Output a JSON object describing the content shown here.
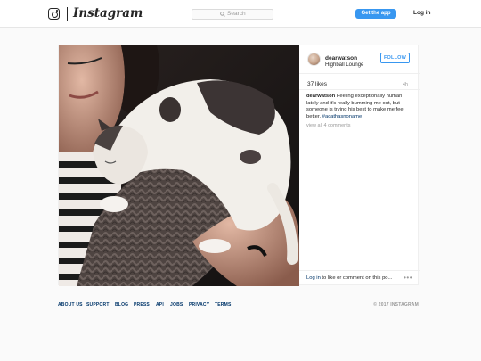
{
  "header": {
    "wordmark": "Instagram",
    "search_placeholder": "Search",
    "get_app_label": "Get the app",
    "login_label": "Log in"
  },
  "post": {
    "username": "dearwatson",
    "location": "Highball Lounge",
    "follow_label": "FOLLOW",
    "likes": "37 likes",
    "time": "4h",
    "caption_username": "dearwatson",
    "caption_text": "Feeling exceptionally human lately and it's really bumming me out, but someone is trying his best to make me feel better.",
    "hashtag": "#acathasnoname",
    "view_all": "view all 4 comments",
    "comment_login": "Log in",
    "comment_prompt": " to like or comment on this po...",
    "more_icon": "more-options-icon"
  },
  "footer": {
    "links": [
      "ABOUT US",
      "SUPPORT",
      "BLOG",
      "PRESS",
      "API",
      "JOBS",
      "PRIVACY",
      "TERMS"
    ],
    "copyright": "© 2017 INSTAGRAM"
  },
  "colors": {
    "accent": "#3897f0",
    "link": "#003569",
    "muted": "#999999"
  }
}
